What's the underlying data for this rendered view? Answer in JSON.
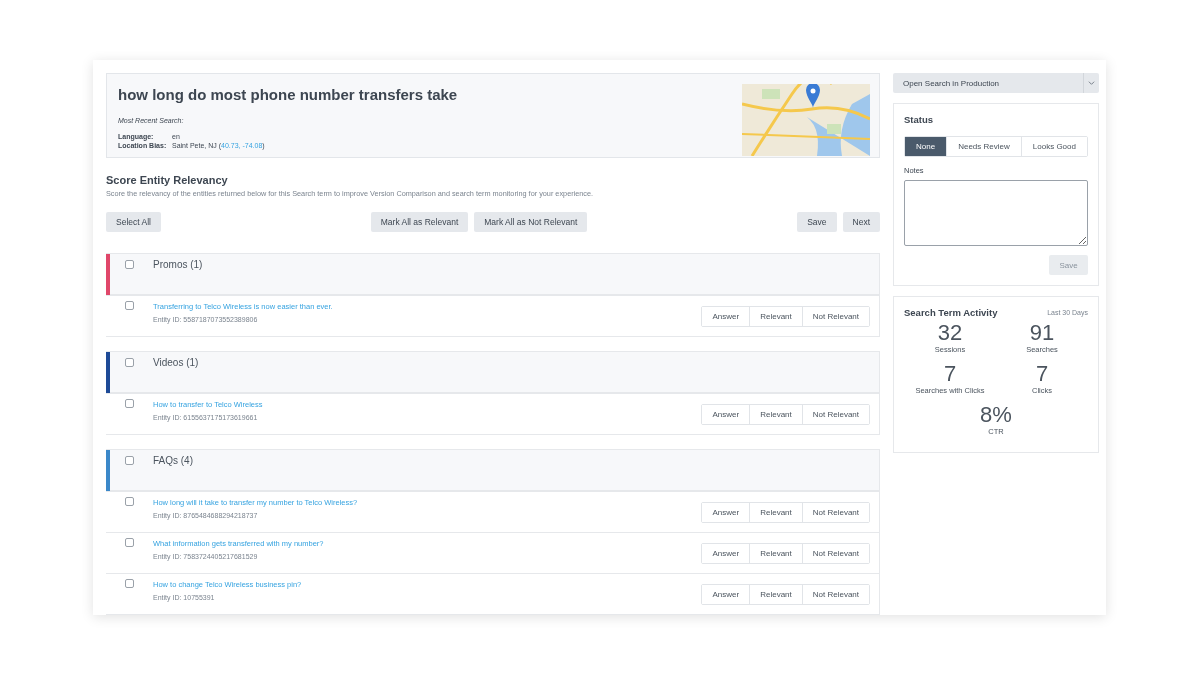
{
  "query": {
    "title": "how long do most phone number transfers take",
    "recent_label": "Most Recent Search:",
    "details": [
      {
        "label": "Language:",
        "value": "en"
      },
      {
        "label": "Location Bias:",
        "value": "Saint Pete, NJ (",
        "link": "40.73, -74.08",
        "suffix": ")"
      }
    ]
  },
  "score": {
    "title": "Score Entity Relevancy",
    "description": "Score the relevancy of the entities returned below for this Search term to improve Version Comparison and search term monitoring for your experience.",
    "select_all": "Select All",
    "mark_buttons": [
      "Mark All as Relevant",
      "Mark All as Not Relevant"
    ],
    "nav_buttons": [
      "Save",
      "Next"
    ]
  },
  "groups": [
    {
      "title": "Promos (1)",
      "color": "#e0476a",
      "checked": false,
      "items": [
        {
          "title": "Transferring to Telco Wireless is now easier than ever.",
          "entity_id": "Entity ID: 5587187073552389806",
          "checked": false,
          "actions": [
            "Answer",
            "Relevant",
            "Not Relevant"
          ]
        }
      ]
    },
    {
      "title": "Videos (1)",
      "color": "#1e4a97",
      "checked": false,
      "items": [
        {
          "title": "How to transfer to Telco Wireless",
          "entity_id": "Entity ID: 6155637175173619661",
          "checked": false,
          "actions": [
            "Answer",
            "Relevant",
            "Not Relevant"
          ]
        }
      ]
    },
    {
      "title": "FAQs (4)",
      "color": "#3b88c9",
      "checked": false,
      "items": [
        {
          "title": "How long will it take to transfer my number to Telco Wireless?",
          "entity_id": "Entity ID: 8765484688294218737",
          "checked": false,
          "actions": [
            "Answer",
            "Relevant",
            "Not Relevant"
          ]
        },
        {
          "title": "What information gets transferred with my number?",
          "entity_id": "Entity ID: 7583724405217681529",
          "checked": false,
          "actions": [
            "Answer",
            "Relevant",
            "Not Relevant"
          ]
        },
        {
          "title": "How to change Telco Wireless business pin?",
          "entity_id": "Entity ID: 10755391",
          "checked": false,
          "actions": [
            "Answer",
            "Relevant",
            "Not Relevant"
          ]
        }
      ]
    }
  ],
  "sidebar": {
    "open_button": "Open Search in Production",
    "status": {
      "title": "Status",
      "options": [
        {
          "label": "None",
          "selected": true
        },
        {
          "label": "Needs Review",
          "selected": false
        },
        {
          "label": "Looks Good",
          "selected": false
        }
      ],
      "notes_label": "Notes",
      "save": "Save",
      "save_disabled": true
    },
    "activity": {
      "title": "Search Term Activity",
      "period": "Last 30 Days",
      "stats": [
        {
          "value": "32",
          "label": "Sessions"
        },
        {
          "value": "91",
          "label": "Searches"
        },
        {
          "value": "7",
          "label": "Searches with Clicks"
        },
        {
          "value": "7",
          "label": "Clicks"
        },
        {
          "value": "8%",
          "label": "CTR"
        }
      ]
    }
  }
}
